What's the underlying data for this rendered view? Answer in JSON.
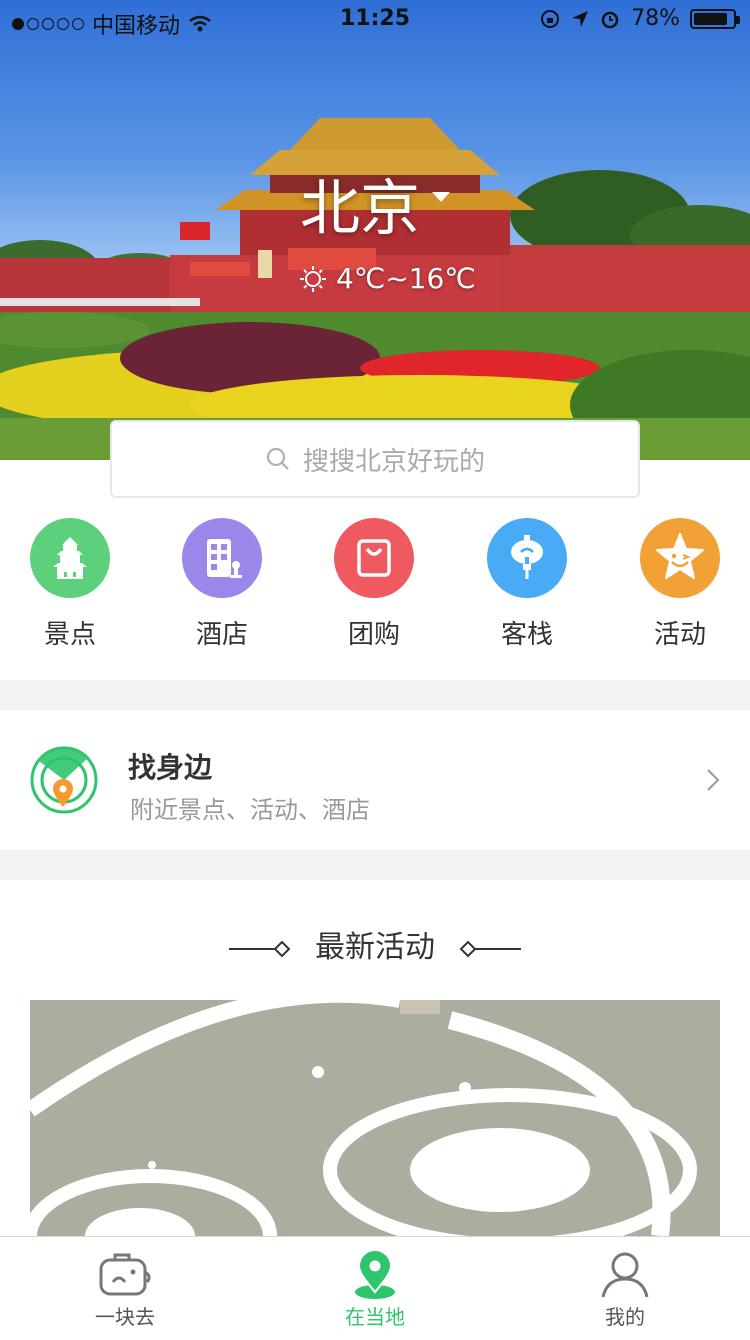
{
  "status_bar": {
    "carrier": "中国移动",
    "time": "11:25",
    "battery": "78%"
  },
  "header": {
    "city": "北京",
    "weather": "4℃~16℃"
  },
  "search": {
    "placeholder": "搜搜北京好玩的"
  },
  "quick_nav": [
    {
      "label": "景点",
      "icon": "temple-icon",
      "color": "#5cd07a"
    },
    {
      "label": "酒店",
      "icon": "hotel-icon",
      "color": "#9b86ea"
    },
    {
      "label": "团购",
      "icon": "shopping-bag-icon",
      "color": "#ee5a60"
    },
    {
      "label": "客栈",
      "icon": "lantern-icon",
      "color": "#49aaf5"
    },
    {
      "label": "活动",
      "icon": "smiley-star-icon",
      "color": "#f2a136"
    }
  ],
  "nearby": {
    "title": "找身边",
    "subtitle": "附近景点、活动、酒店"
  },
  "activities": {
    "section_title": "最新活动"
  },
  "tabbar": {
    "active_color": "#2fc56d",
    "items": [
      {
        "label": "一块去",
        "icon": "elephant-bag-icon"
      },
      {
        "label": "在当地",
        "icon": "location-pin-icon"
      },
      {
        "label": "我的",
        "icon": "user-icon"
      }
    ]
  }
}
